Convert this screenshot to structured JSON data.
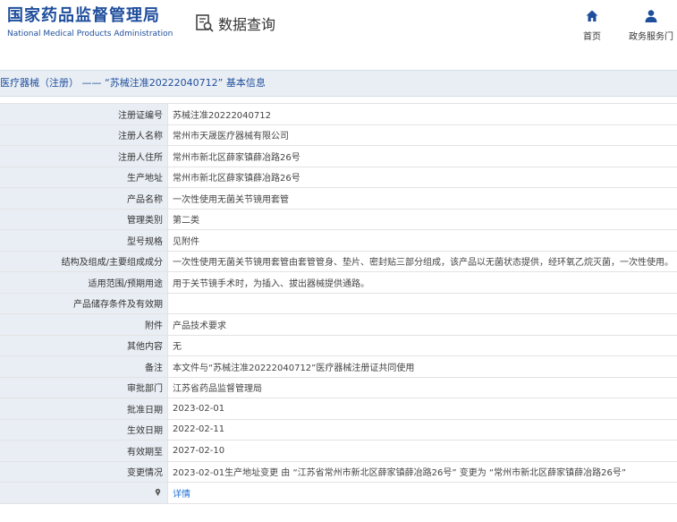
{
  "header": {
    "site_name_cn": "国家药品监督管理局",
    "site_name_en": "National Medical Products Administration",
    "data_query_label": "数据查询",
    "nav_home": "首页",
    "nav_gov": "政务服务门",
    "accent_color": "#1f4e9c"
  },
  "page": {
    "title": "医疗器械（注册） —— “苏械注准20222040712” 基本信息"
  },
  "rows": [
    {
      "label": "注册证编号",
      "value": "苏械注准20222040712"
    },
    {
      "label": "注册人名称",
      "value": "常州市天晟医疗器械有限公司"
    },
    {
      "label": "注册人住所",
      "value": "常州市新北区薛家镇薛冶路26号"
    },
    {
      "label": "生产地址",
      "value": "常州市新北区薛家镇薛冶路26号"
    },
    {
      "label": "产品名称",
      "value": "一次性使用无菌关节镜用套管"
    },
    {
      "label": "管理类别",
      "value": "第二类"
    },
    {
      "label": "型号规格",
      "value": "见附件"
    },
    {
      "label": "结构及组成/主要组成成分",
      "value": "一次性使用无菌关节镜用套管由套管管身、垫片、密封贴三部分组成，该产品以无菌状态提供，经环氧乙烷灭菌，一次性使用。"
    },
    {
      "label": "适用范围/预期用途",
      "value": "用于关节镜手术时，为插入、拔出器械提供通路。"
    },
    {
      "label": "产品储存条件及有效期",
      "value": ""
    },
    {
      "label": "附件",
      "value": "产品技术要求"
    },
    {
      "label": "其他内容",
      "value": "无"
    },
    {
      "label": "备注",
      "value": "本文件与“苏械注准20222040712”医疗器械注册证共同使用"
    },
    {
      "label": "审批部门",
      "value": "江苏省药品监督管理局"
    },
    {
      "label": "批准日期",
      "value": "2023-02-01"
    },
    {
      "label": "生效日期",
      "value": "2022-02-11"
    },
    {
      "label": "有效期至",
      "value": "2027-02-10"
    },
    {
      "label": "变更情况",
      "value": "2023-02-01生产地址变更 由 “江苏省常州市新北区薛家镇薛冶路26号” 变更为 “常州市新北区薛家镇薛冶路26号”"
    }
  ],
  "detail_row": {
    "icon": "pin-icon",
    "link_text": "详情"
  }
}
